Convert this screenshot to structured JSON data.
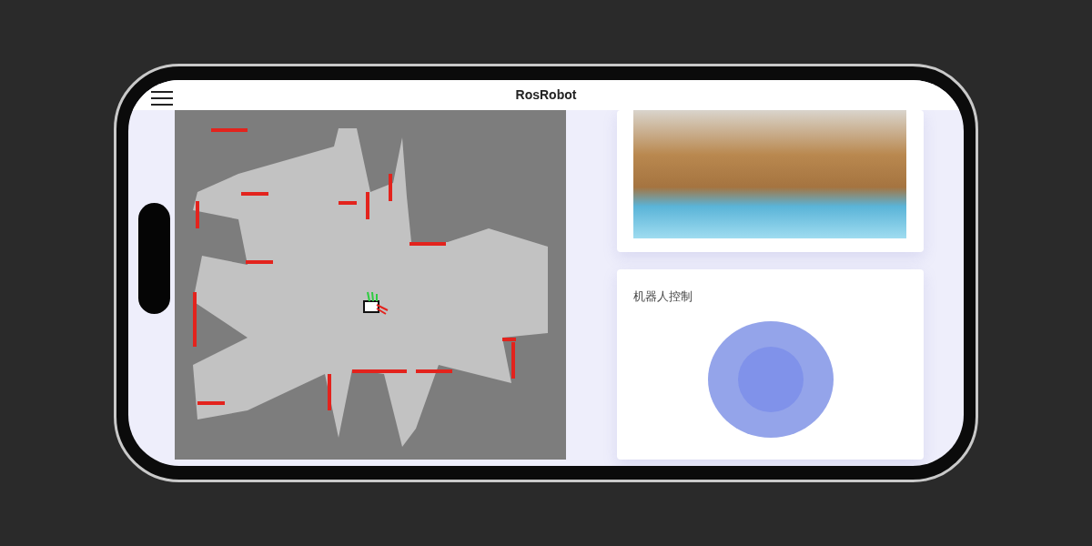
{
  "app": {
    "title": "RosRobot"
  },
  "control_panel": {
    "title": "机器人控制"
  }
}
